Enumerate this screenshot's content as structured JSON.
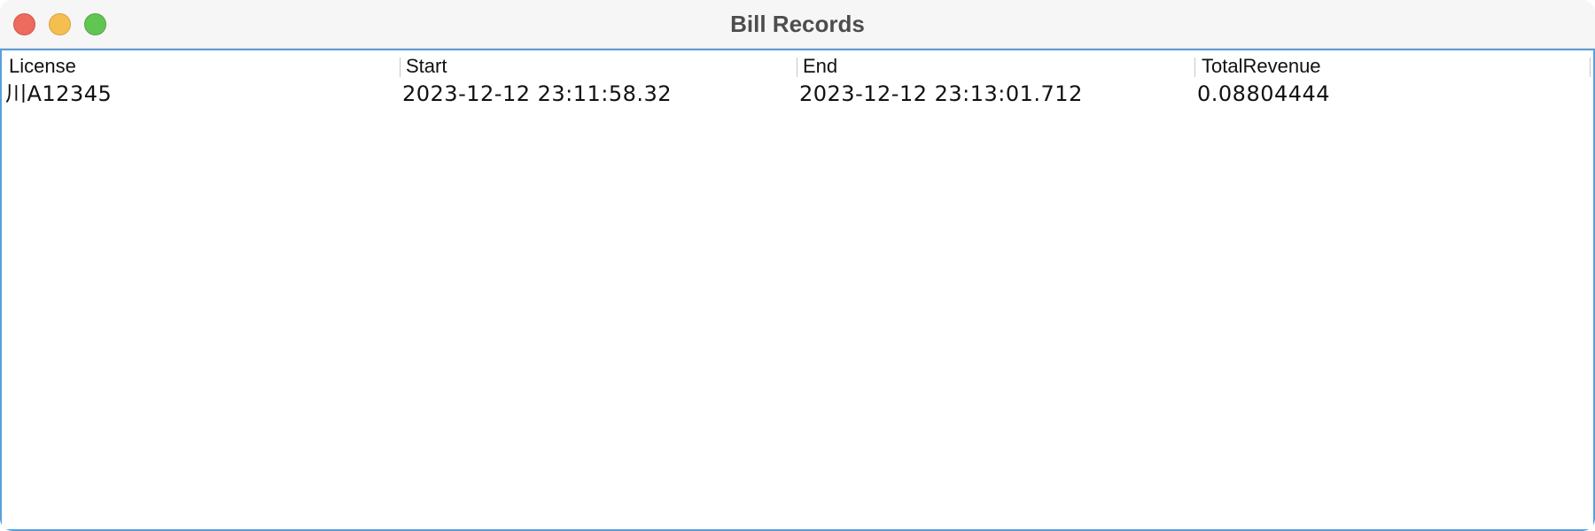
{
  "window": {
    "title": "Bill Records"
  },
  "table": {
    "columns": [
      "License",
      "Start",
      "End",
      "TotalRevenue"
    ],
    "rows": [
      [
        "川A12345",
        "2023-12-12 23:11:58.32",
        "2023-12-12 23:13:01.712",
        "0.08804444"
      ]
    ]
  },
  "colors": {
    "accent_border": "#5a9fd9",
    "close": "#ed6a5e",
    "minimize": "#f5bf4f",
    "zoom": "#61c554"
  }
}
